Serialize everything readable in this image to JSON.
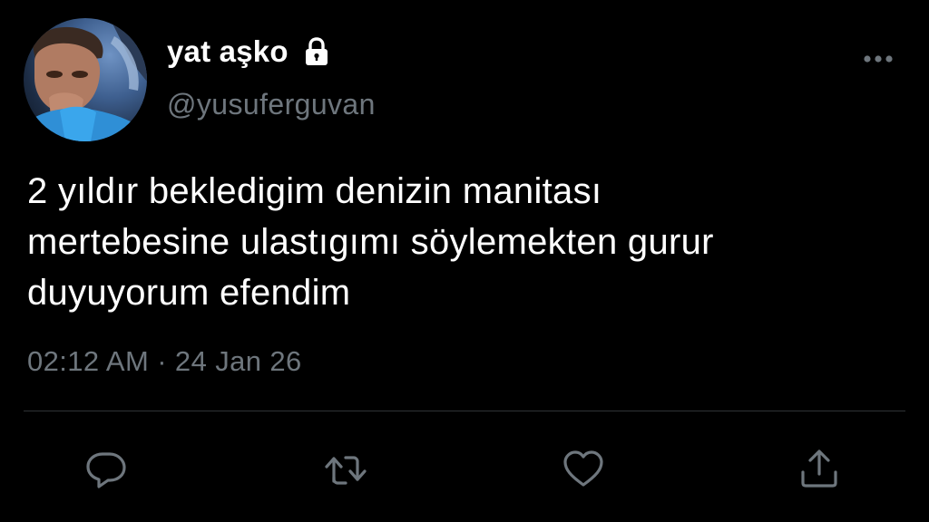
{
  "tweet": {
    "display_name": "yat aşko",
    "handle": "@yusuferguvan",
    "text": "2 yıldır bekledigim denizin manitası\nmertebesine ulastıgımı söylemekten gurur\nduyuyorum efendim",
    "timestamp": "02:12 AM · 24 Jan 26",
    "protected_icon": "lock-icon",
    "avatar_icon": "profile-photo"
  },
  "actions": {
    "reply_icon": "reply-icon",
    "retweet_icon": "retweet-icon",
    "like_icon": "heart-icon",
    "share_icon": "share-icon",
    "more_icon": "more-icon"
  },
  "colors": {
    "background": "#000000",
    "text": "#ffffff",
    "secondary_text": "#6e767d",
    "divider": "#2f3336"
  }
}
